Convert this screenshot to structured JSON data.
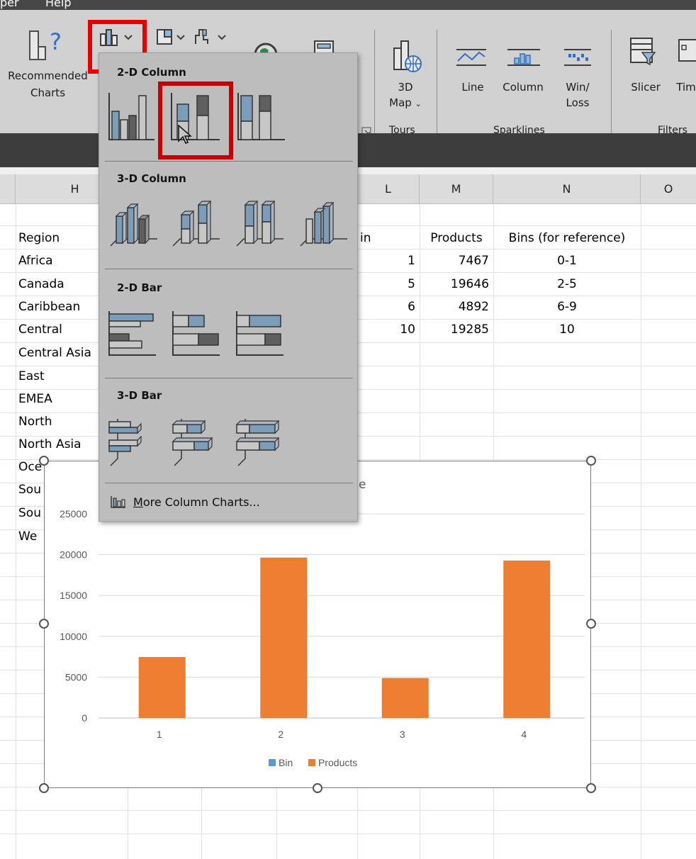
{
  "menubar": {
    "items": [
      "per",
      "Help"
    ]
  },
  "ribbon": {
    "recommended_charts": {
      "line1": "Recommended",
      "line2": "Charts"
    },
    "map3d": {
      "line1": "3D",
      "line2": "Map"
    },
    "tours_group": "Tours",
    "sparklines": {
      "line": "Line",
      "column": "Column",
      "winloss_1": "Win/",
      "winloss_2": "Loss",
      "group": "Sparklines"
    },
    "slicer": "Slicer",
    "timeline_partial": "Tim",
    "filters_group": "Filters"
  },
  "columns": [
    "H",
    "L",
    "M",
    "N",
    "O"
  ],
  "sheet": {
    "region_header": "Region",
    "regions": [
      "Africa",
      "Canada",
      "Caribbean",
      "Central",
      "Central Asia",
      "East",
      "EMEA",
      "North",
      "North Asia",
      "Oce",
      "Sou",
      "Sou",
      "We"
    ],
    "bin_header_partial": "in",
    "products_header": "Products",
    "bins_ref_header": "Bins (for reference)",
    "rows": [
      {
        "bin": "1",
        "products": "7467",
        "ref": "0-1"
      },
      {
        "bin": "5",
        "products": "19646",
        "ref": "2-5"
      },
      {
        "bin": "6",
        "products": "4892",
        "ref": "6-9"
      },
      {
        "bin": "10",
        "products": "19285",
        "ref": "10"
      }
    ]
  },
  "dropdown": {
    "section_2d_column": "2-D Column",
    "section_3d_column": "3-D Column",
    "section_2d_bar": "2-D Bar",
    "section_3d_bar": "3-D Bar",
    "more_prefix": "M",
    "more_rest": "ore Column Charts..."
  },
  "chart_title_fragment": "e",
  "colors": {
    "bar_orange": "#ed7d31",
    "bin_blue": "#5b9bd5",
    "highlight": "#ff0000"
  },
  "chart_data": {
    "type": "bar",
    "categories": [
      "1",
      "2",
      "3",
      "4"
    ],
    "series": [
      {
        "name": "Bin",
        "values": [
          1,
          5,
          6,
          10
        ]
      },
      {
        "name": "Products",
        "values": [
          7467,
          19646,
          4892,
          19285
        ]
      }
    ],
    "yticks": [
      "0",
      "5000",
      "10000",
      "15000",
      "20000",
      "25000"
    ],
    "ylim": [
      0,
      25000
    ],
    "legend": "bottom",
    "grid": true
  }
}
